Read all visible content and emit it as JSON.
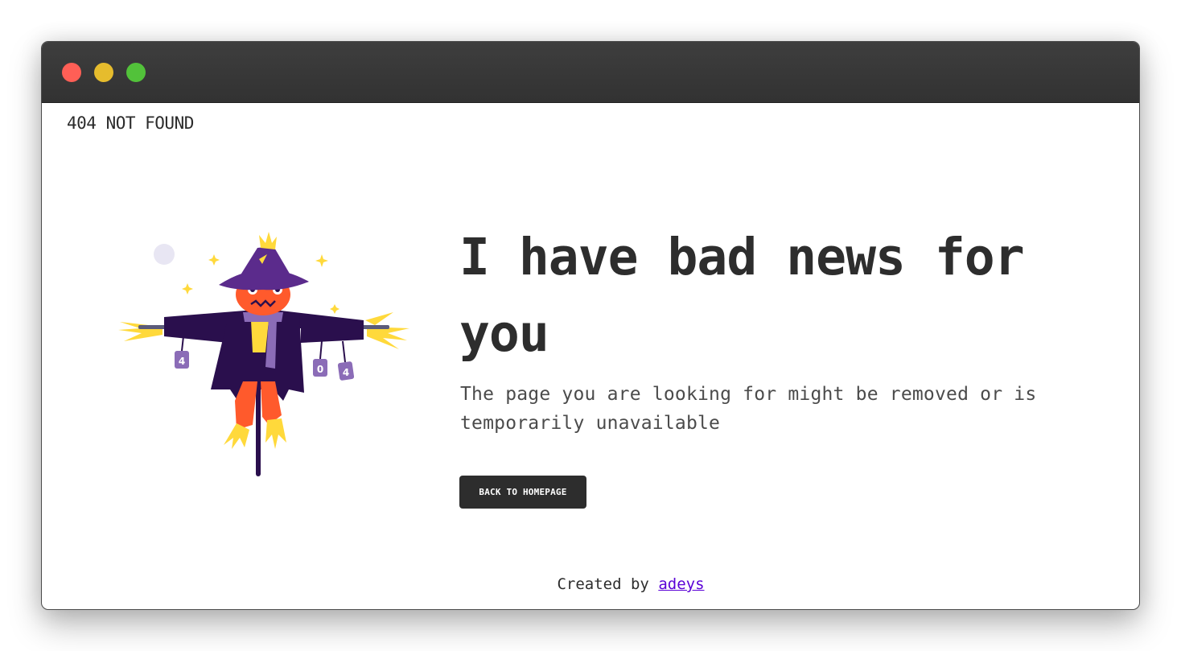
{
  "window": {
    "controls": {
      "close_color": "#ff5f56",
      "minimize_color": "#e6bc2d",
      "maximize_color": "#52c23a"
    }
  },
  "header": {
    "title": "404 NOT FOUND"
  },
  "main": {
    "headline": "I have bad news for you",
    "message": "The page you are looking for might be removed or is temporarily unavailable",
    "button_label": "BACK TO HOMEPAGE",
    "illustration": {
      "icon": "scarecrow-illustration",
      "cans": [
        "4",
        "0",
        "4"
      ],
      "colors": {
        "hat": "#5b2b8c",
        "coat": "#2a0f4d",
        "face": "#ff5a2c",
        "straw": "#ffd93b",
        "can": "#8b6cb7"
      }
    }
  },
  "footer": {
    "prefix": "Created by",
    "link_text": "adeys",
    "link_color": "#5a00d6"
  },
  "colors": {
    "text_primary": "#2d2d2d",
    "button_bg": "#2d2d2d",
    "titlebar_bg": "#383838"
  }
}
